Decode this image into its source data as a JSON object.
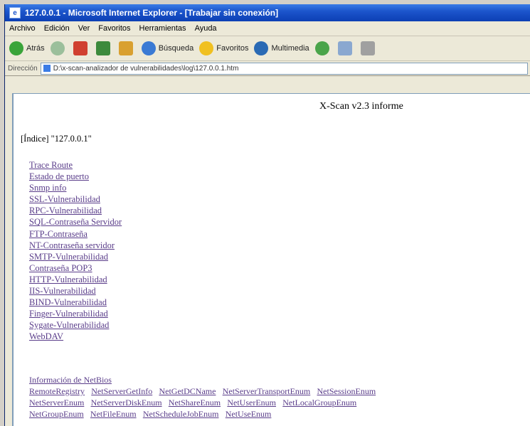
{
  "window": {
    "title": "127.0.0.1 - Microsoft Internet Explorer - [Trabajar sin conexión]"
  },
  "menu": [
    "Archivo",
    "Edición",
    "Ver",
    "Favoritos",
    "Herramientas",
    "Ayuda"
  ],
  "toolbar": {
    "back_label": "Atrás",
    "search_label": "Búsqueda",
    "favorites_label": "Favoritos",
    "multimedia_label": "Multimedia"
  },
  "address": {
    "label": "Dirección",
    "value": "D:\\x-scan-analizador de vulnerabilidades\\log\\127.0.0.1.htm"
  },
  "report": {
    "title": "X-Scan v2.3 informe",
    "host_line": "[Índice] \"127.0.0.1\"",
    "links": [
      "Trace Route",
      "Estado de puerto",
      "Snmp info",
      "SSL-Vulnerabilidad",
      "RPC-Vulnerabilidad",
      "SQL-Contraseña Servidor",
      "FTP-Contraseña",
      "NT-Contraseña servidor",
      "SMTP-Vulnerabilidad",
      "Contraseña POP3",
      "HTTP-Vulnerabilidad",
      "IIS-Vulnerabilidad",
      "BIND-Vulnerabilidad",
      "Finger-Vulnerabilidad",
      "Sygate-Vulnerabilidad",
      "WebDAV"
    ],
    "netbios_title": "Información de NetBios",
    "netbios_rows": [
      [
        "RemoteRegistry",
        "NetServerGetInfo",
        "NetGetDCName",
        "NetServerTransportEnum",
        "NetSessionEnum"
      ],
      [
        "NetServerEnum",
        "NetServerDiskEnum",
        "NetShareEnum",
        "NetUserEnum",
        "NetLocalGroupEnum"
      ],
      [
        "NetGroupEnum",
        "NetFileEnum",
        "NetScheduleJobEnum",
        "NetUseEnum"
      ]
    ]
  },
  "colors": {
    "titlebar": "#1c55cc",
    "link_visited": "#5a3d8a"
  }
}
